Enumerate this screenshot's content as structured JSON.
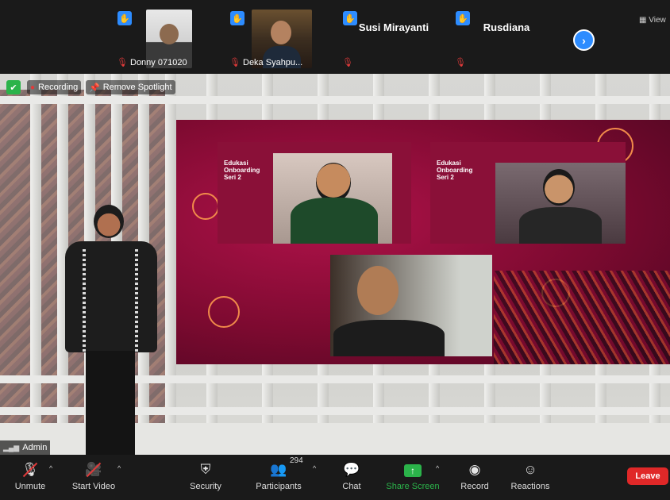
{
  "strip": {
    "participants": [
      {
        "label": "Donny 071020",
        "has_video": true
      },
      {
        "label": "Deka Syahpu...",
        "has_video": true
      },
      {
        "label": "Susi Mirayanti",
        "has_video": false
      },
      {
        "label": "Rusdiana",
        "has_video": false
      }
    ],
    "view_label": "View"
  },
  "stage": {
    "recording_label": "Recording",
    "remove_spotlight_label": "Remove Spotlight",
    "admin_label": "Admin",
    "slide_title_1": "Edukasi Onboarding Seri 2",
    "slide_title_2": "Edukasi Onboarding Seri 2"
  },
  "toolbar": {
    "unmute": "Unmute",
    "start_video": "Start Video",
    "security": "Security",
    "participants": "Participants",
    "participants_count": "294",
    "chat": "Chat",
    "share_screen": "Share Screen",
    "record": "Record",
    "reactions": "Reactions",
    "leave": "Leave"
  },
  "colors": {
    "accent_blue": "#2d8cff",
    "share_green": "#2bb34a",
    "leave_red": "#e02828",
    "muted_red": "#e03a3a"
  }
}
